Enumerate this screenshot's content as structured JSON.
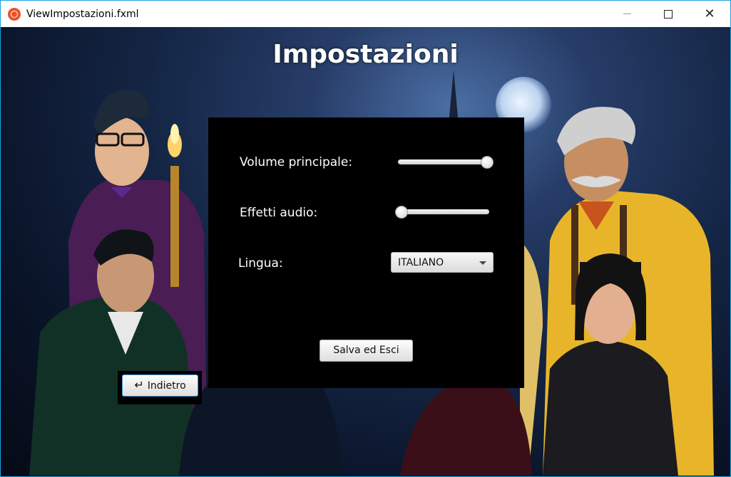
{
  "window": {
    "title": "ViewImpostazioni.fxml",
    "minimize_icon": "minimize-icon",
    "maximize_icon": "maximize-icon",
    "close_icon": "close-icon"
  },
  "page": {
    "title": "Impostazioni"
  },
  "settings": {
    "volume_label": "Volume principale:",
    "volume_value": 1.0,
    "effects_label": "Effetti audio:",
    "effects_value": 0.0,
    "language_label": "Lingua:",
    "language_selected": "ITALIANO",
    "save_label": "Salva ed Esci"
  },
  "back": {
    "label": "Indietro",
    "icon": "enter-return-icon"
  },
  "colors": {
    "window_border": "#1ba1e2",
    "panel_bg": "#000000",
    "focus_ring": "#3b9be0"
  }
}
